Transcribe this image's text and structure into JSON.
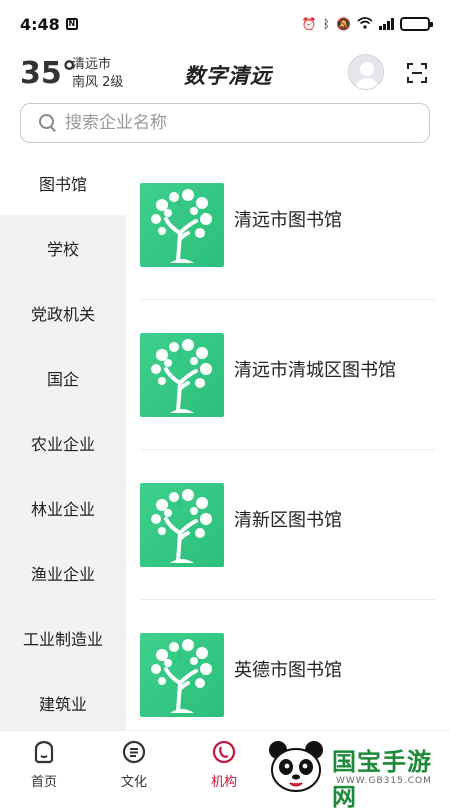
{
  "status": {
    "time": "4:48",
    "nfc": "N"
  },
  "header": {
    "temperature": "35°",
    "city": "清远市",
    "wind": "南风  2级",
    "app_title": "数字清远"
  },
  "search": {
    "placeholder": "搜索企业名称"
  },
  "sidebar": {
    "items": [
      {
        "label": "图书馆",
        "active": true
      },
      {
        "label": "学校"
      },
      {
        "label": "党政机关"
      },
      {
        "label": "国企"
      },
      {
        "label": "农业企业"
      },
      {
        "label": "林业企业"
      },
      {
        "label": "渔业企业"
      },
      {
        "label": "工业制造业"
      },
      {
        "label": "建筑业"
      }
    ]
  },
  "orgs": [
    {
      "name": "清远市图书馆",
      "icon": "money-tree-icon"
    },
    {
      "name": "清远市清城区图书馆",
      "icon": "money-tree-icon"
    },
    {
      "name": "清新区图书馆",
      "icon": "money-tree-icon"
    },
    {
      "name": "英德市图书馆",
      "icon": "money-tree-icon"
    }
  ],
  "tabbar": {
    "tabs": [
      {
        "label": "首页",
        "icon": "home-icon"
      },
      {
        "label": "文化",
        "icon": "document-icon"
      },
      {
        "label": "机构",
        "icon": "organization-icon",
        "active": true
      }
    ]
  },
  "watermark": {
    "text": "国宝手游网",
    "url": "WWW.GB315.COM"
  },
  "colors": {
    "accent": "#c4163a",
    "thumb": "#3ed08c",
    "watermark": "#1d8a3a"
  }
}
